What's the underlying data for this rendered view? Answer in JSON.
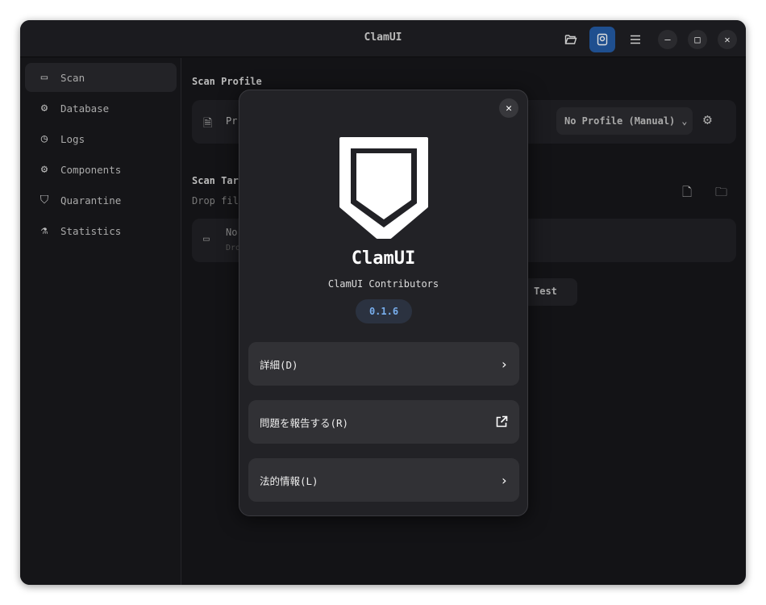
{
  "window": {
    "title": "ClamUI"
  },
  "header": {
    "open_icon": "folder-open-icon",
    "active_icon": "scan-icon",
    "menu_icon": "menu-icon",
    "minimize": "–",
    "maximize": "□",
    "close": "✕"
  },
  "sidebar": {
    "items": [
      {
        "label": "Scan",
        "icon": "folder-icon"
      },
      {
        "label": "Database",
        "icon": "gear-icon"
      },
      {
        "label": "Logs",
        "icon": "clock-icon"
      },
      {
        "label": "Components",
        "icon": "gear-icon"
      },
      {
        "label": "Quarantine",
        "icon": "shield-icon"
      },
      {
        "label": "Statistics",
        "icon": "flask-icon"
      }
    ]
  },
  "main": {
    "scan_profile_heading": "Scan Profile",
    "profile_label_partial": "Pr",
    "profile_select": "No Profile (Manual)",
    "scan_targets_heading": "Scan Targ",
    "drop_hint_partial": "Drop file",
    "target_title_partial": "No",
    "target_sub_partial": "Dro",
    "test_button": "Test"
  },
  "about": {
    "app_name": "ClamUI",
    "developer": "ClamUI Contributors",
    "version": "0.1.6",
    "close": "✕",
    "rows": [
      {
        "label": "詳細(D)",
        "icon": "chevron-right-icon"
      },
      {
        "label": "問題を報告する(R)",
        "icon": "external-link-icon"
      },
      {
        "label": "法的情報(L)",
        "icon": "chevron-right-icon"
      }
    ]
  }
}
